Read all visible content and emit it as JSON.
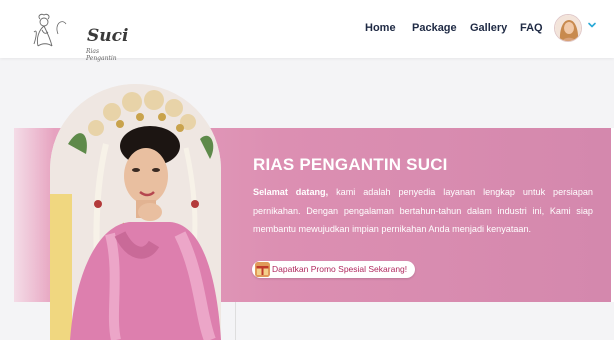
{
  "brand": {
    "name": "Suci",
    "tagline": "Rias Pengantin"
  },
  "nav": {
    "items": [
      "Home",
      "Package",
      "Gallery",
      "FAQ"
    ]
  },
  "icons": {
    "caret": "chevron-down-icon",
    "promo": "gift-icon",
    "avatar": "user-avatar"
  },
  "hero": {
    "title": "RIAS PENGANTIN SUCI",
    "intro_bold": "Selamat datang,",
    "intro_rest": " kami adalah penyedia layanan lengkap untuk persiapan pernikahan. Dengan pengalaman bertahun-tahun dalam industri ini, Kami siap membantu mewujudkan impian pernikahan Anda menjadi kenyataan.",
    "promo_label": "Dapatkan Promo Spesial Sekarang!"
  },
  "colors": {
    "banner": "#dc8fb2",
    "nav_text": "#1f2a44",
    "promo_text": "#b0285e",
    "accent_chevron": "#2aa9d6"
  }
}
